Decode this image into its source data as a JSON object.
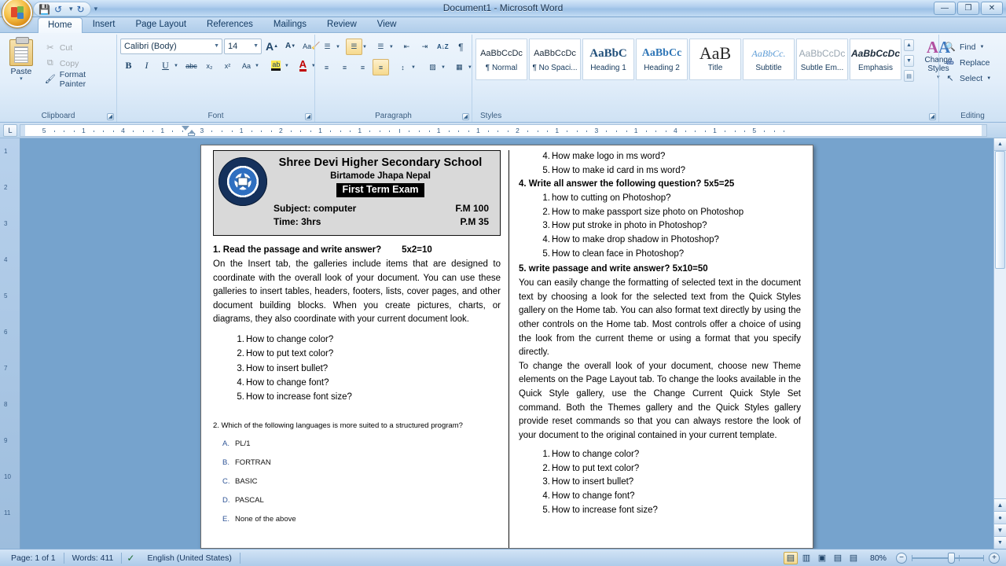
{
  "window": {
    "title": "Document1 - Microsoft Word",
    "buttons": {
      "minimize": "—",
      "restore": "❐",
      "close": "✕"
    }
  },
  "quick_access": {
    "office_button": "office-orb",
    "save": "💾",
    "undo": "↺",
    "redo": "↻",
    "customize": "▾"
  },
  "tabs": [
    {
      "label": "Home",
      "active": true
    },
    {
      "label": "Insert",
      "active": false
    },
    {
      "label": "Page Layout",
      "active": false
    },
    {
      "label": "References",
      "active": false
    },
    {
      "label": "Mailings",
      "active": false
    },
    {
      "label": "Review",
      "active": false
    },
    {
      "label": "View",
      "active": false
    }
  ],
  "ribbon": {
    "clipboard": {
      "label": "Clipboard",
      "paste": "Paste",
      "cut": "Cut",
      "copy": "Copy",
      "format_painter": "Format Painter"
    },
    "font": {
      "label": "Font",
      "font_name": "Calibri (Body)",
      "font_size": "14",
      "grow_font": "A",
      "shrink_font": "A",
      "clear_formatting": "Aa",
      "bold": "B",
      "italic": "I",
      "underline": "U",
      "strikethrough": "abc",
      "subscript": "x₂",
      "superscript": "x²",
      "change_case": "Aa",
      "highlight": "ab",
      "font_color": "A"
    },
    "paragraph": {
      "label": "Paragraph",
      "bullets": "☰",
      "numbering": "☰",
      "multilevel": "☰",
      "decrease_indent": "⇤",
      "increase_indent": "⇥",
      "sort": "A↓Z",
      "show_marks": "¶",
      "align_left": "≡",
      "align_center": "≡",
      "align_right": "≡",
      "justify": "≡",
      "line_spacing": "↕",
      "shading": "▨",
      "borders": "▦"
    },
    "styles": {
      "label": "Styles",
      "items": [
        {
          "preview": "AaBbCcDc",
          "name": "¶ Normal"
        },
        {
          "preview": "AaBbCcDc",
          "name": "¶ No Spaci..."
        },
        {
          "preview": "AaBbC",
          "name": "Heading 1"
        },
        {
          "preview": "AaBbCc",
          "name": "Heading 2"
        },
        {
          "preview": "AaB",
          "name": "Title"
        },
        {
          "preview": "AaBbCc.",
          "name": "Subtitle"
        },
        {
          "preview": "AaBbCcDc",
          "name": "Subtle Em..."
        },
        {
          "preview": "AaBbCcDc",
          "name": "Emphasis"
        }
      ],
      "change_styles": "Change Styles"
    },
    "editing": {
      "label": "Editing",
      "find": "Find",
      "replace": "Replace",
      "select": "Select"
    }
  },
  "ruler": {
    "corner_tab": "L",
    "left_numbers": [
      "5",
      "1",
      "4",
      "1",
      "3",
      "1",
      "2",
      "1",
      "1"
    ],
    "right_numbers": [
      "1",
      "1",
      "2",
      "1",
      "3",
      "1",
      "4",
      "1",
      "5"
    ],
    "vertical_numbers": [
      "1",
      "2",
      "3",
      "4",
      "5",
      "6",
      "7",
      "8",
      "9",
      "10",
      "11"
    ]
  },
  "document": {
    "exam_header": {
      "school": "Shree Devi Higher Secondary School",
      "address": "Birtamode Jhapa Nepal",
      "term": "First Term Exam",
      "subject_label": "Subject: computer",
      "full_marks": "F.M 100",
      "time_label": "Time: 3hrs",
      "pass_marks": "P.M 35"
    },
    "left_column": {
      "q1_heading": "1. Read the passage and write answer?",
      "q1_marks": "5x2=10",
      "q1_passage": "On the Insert tab, the galleries include items that are designed to coordinate with the overall look of your document. You can use these galleries to insert tables, headers, footers, lists, cover pages, and other document building blocks. When you create pictures, charts, or diagrams, they also coordinate with your current document look.",
      "q1_items": [
        {
          "n": "1.",
          "text": "How to change color?"
        },
        {
          "n": "2.",
          "text": "How to put text color?"
        },
        {
          "n": "3.",
          "text": "How to insert bullet?"
        },
        {
          "n": "4.",
          "text": "How to change font?"
        },
        {
          "n": "5.",
          "text": "How to increase font size?"
        }
      ],
      "q2_text": "2. Which of the following languages is more suited to a structured program?",
      "q2_options": [
        {
          "n": "A.",
          "text": "PL/1"
        },
        {
          "n": "B.",
          "text": "FORTRAN"
        },
        {
          "n": "C.",
          "text": "BASIC"
        },
        {
          "n": "D.",
          "text": "PASCAL"
        },
        {
          "n": "E.",
          "text": "None of the above"
        }
      ]
    },
    "right_column": {
      "carryover_items": [
        {
          "n": "4.",
          "text": "How make logo in ms word?"
        },
        {
          "n": "5.",
          "text": "How to make id card in ms word?"
        }
      ],
      "q4_heading": "4. Write all answer the following question? 5x5=25",
      "q4_items": [
        {
          "n": "1.",
          "text": "how to cutting on Photoshop?"
        },
        {
          "n": "2.",
          "text": "How to make passport size photo on Photoshop"
        },
        {
          "n": "3.",
          "text": "How put stroke in photo in Photoshop?"
        },
        {
          "n": "4.",
          "text": "How to make drop shadow in Photoshop?"
        },
        {
          "n": "5.",
          "text": "How to clean face in Photoshop?"
        }
      ],
      "q5_heading": "5. write passage and write answer? 5x10=50",
      "q5_para1": "You can easily change the formatting of selected text in the document text by choosing a look for the selected text from the Quick Styles gallery on the Home tab. You can also format text directly by using the other controls on the Home tab. Most controls offer a choice of using the look from the current theme or using a format that you specify directly.",
      "q5_para2": "To change the overall look of your document, choose new Theme elements on the Page Layout tab. To change the looks available in the Quick Style gallery, use the Change Current Quick Style Set command. Both the Themes gallery and the Quick Styles gallery provide reset commands so that you can always restore the look of your document to the original contained in your current template.",
      "q5_items": [
        {
          "n": "1.",
          "text": "How to change color?"
        },
        {
          "n": "2.",
          "text": "How to put text color?"
        },
        {
          "n": "3.",
          "text": "How to insert bullet?"
        },
        {
          "n": "4.",
          "text": "How to change font?"
        },
        {
          "n": "5.",
          "text": "How to increase font size?"
        }
      ]
    }
  },
  "status_bar": {
    "page": "Page: 1 of 1",
    "words": "Words: 411",
    "spell_icon": "✓",
    "language": "English (United States)",
    "views": [
      {
        "icon": "▤",
        "name": "print-layout",
        "active": true
      },
      {
        "icon": "▥",
        "name": "full-screen-reading",
        "active": false
      },
      {
        "icon": "▣",
        "name": "web-layout",
        "active": false
      },
      {
        "icon": "▤",
        "name": "outline",
        "active": false
      },
      {
        "icon": "▤",
        "name": "draft",
        "active": false
      }
    ],
    "zoom": "80%",
    "zoom_out": "−",
    "zoom_in": "+"
  }
}
